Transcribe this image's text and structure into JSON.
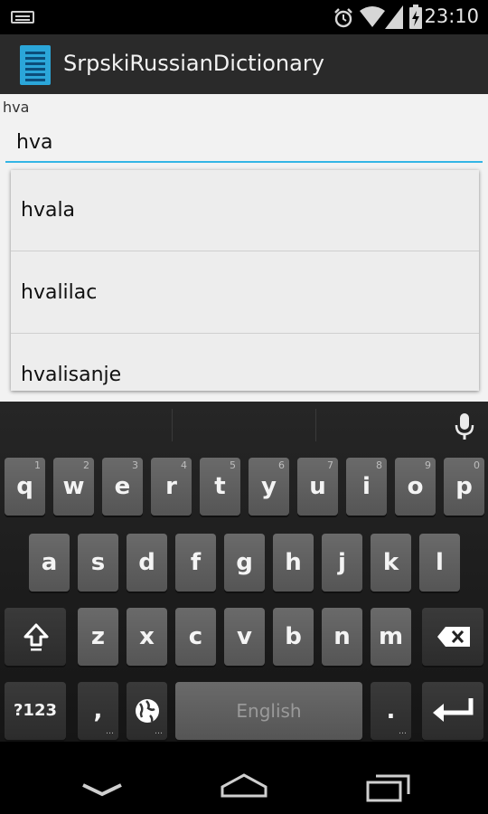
{
  "status_bar": {
    "time": "23:10",
    "icons": [
      "keyboard-icon",
      "alarm-icon",
      "wifi-icon",
      "signal-icon",
      "battery-charging-icon"
    ]
  },
  "action_bar": {
    "title": "SrpskiRussianDictionary",
    "icon": "app-icon"
  },
  "search": {
    "label": "hva",
    "value": "hva"
  },
  "suggestions": [
    "hvala",
    "hvalilac",
    "hvalisanje"
  ],
  "keyboard": {
    "row1": [
      {
        "char": "q",
        "num": "1"
      },
      {
        "char": "w",
        "num": "2"
      },
      {
        "char": "e",
        "num": "3"
      },
      {
        "char": "r",
        "num": "4"
      },
      {
        "char": "t",
        "num": "5"
      },
      {
        "char": "y",
        "num": "6"
      },
      {
        "char": "u",
        "num": "7"
      },
      {
        "char": "i",
        "num": "8"
      },
      {
        "char": "o",
        "num": "9"
      },
      {
        "char": "p",
        "num": "0"
      }
    ],
    "row2": [
      "a",
      "s",
      "d",
      "f",
      "g",
      "h",
      "j",
      "k",
      "l"
    ],
    "row3": [
      "z",
      "x",
      "c",
      "v",
      "b",
      "n",
      "m"
    ],
    "symbols_label": "?123",
    "comma_label": ",",
    "space_label": "English",
    "period_label": "."
  },
  "colors": {
    "accent": "#33b5e5",
    "action_bar": "#2a2a2a",
    "content_bg": "#f2f2f2"
  }
}
